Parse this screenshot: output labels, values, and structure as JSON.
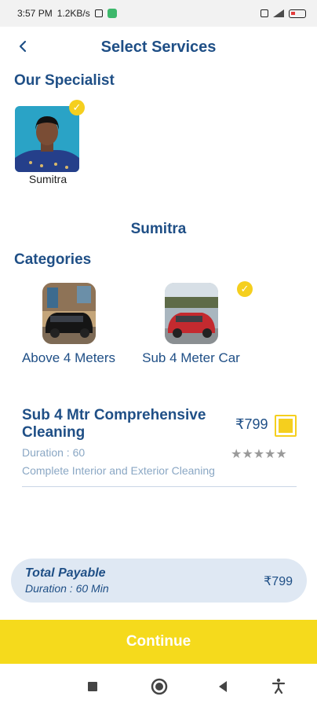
{
  "status_bar": {
    "time": "3:57 PM",
    "speed": "1.2KB/s"
  },
  "header": {
    "back_icon": "chevron-left-icon",
    "title": "Select Services"
  },
  "specialists": {
    "section_title": "Our Specialist",
    "items": [
      {
        "name": "Sumitra",
        "selected": true
      }
    ]
  },
  "selected_specialist_name": "Sumitra",
  "categories": {
    "section_title": "Categories",
    "items": [
      {
        "label": "Above 4 Meters",
        "selected": false
      },
      {
        "label": "Sub 4 Meter Car",
        "selected": true
      }
    ]
  },
  "services": [
    {
      "name": "Sub 4 Mtr Comprehensive Cleaning",
      "price": "₹799",
      "duration": "Duration : 60",
      "description": "Complete Interior and Exterior Cleaning",
      "rating": 0,
      "rating_max": 5,
      "stars_text": "★★★★★",
      "selected": true
    }
  ],
  "total": {
    "title": "Total Payable",
    "duration": "Duration : 60 Min",
    "amount": "₹799"
  },
  "continue_label": "Continue",
  "colors": {
    "primary": "#1f4f86",
    "accent": "#f5da1c",
    "muted": "#8aa7c4",
    "total_bg": "#dfe8f3"
  }
}
